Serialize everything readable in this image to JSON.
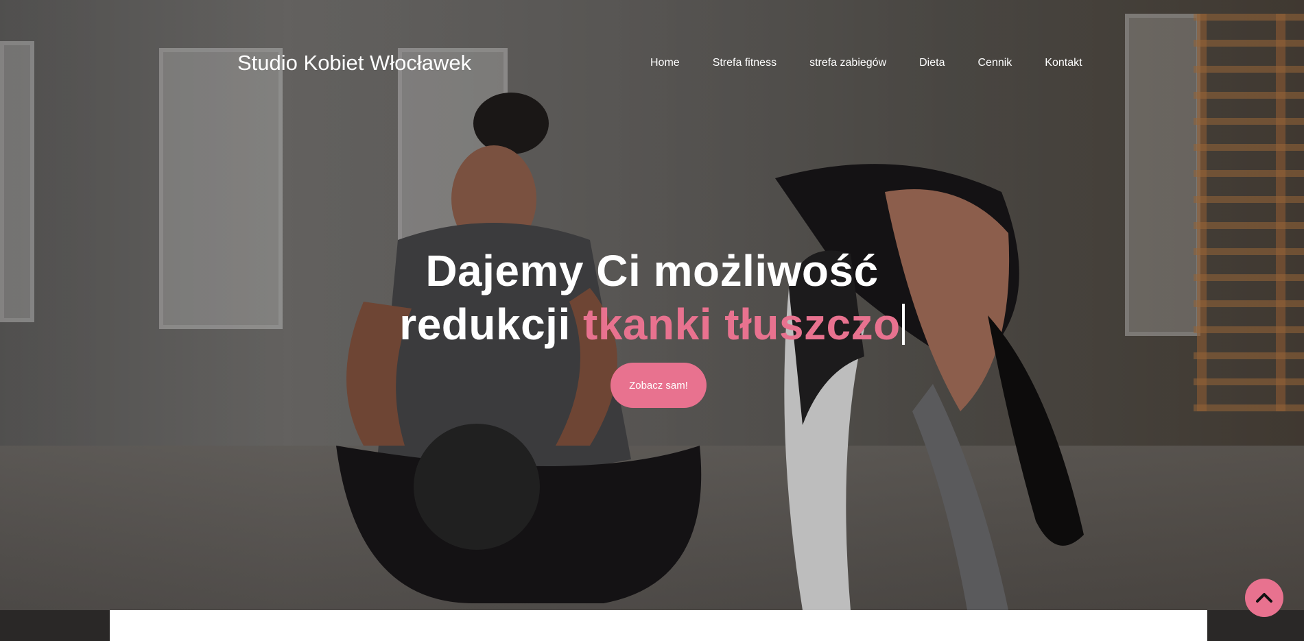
{
  "header": {
    "brand": "Studio Kobiet Włocławek",
    "nav": [
      {
        "label": "Home"
      },
      {
        "label": "Strefa fitness"
      },
      {
        "label": "strefa zabiegów"
      },
      {
        "label": "Dieta"
      },
      {
        "label": "Cennik"
      },
      {
        "label": "Kontakt"
      }
    ]
  },
  "hero": {
    "line1": "Dajemy Ci możliwość",
    "line2_prefix": "redukcji ",
    "line2_highlight": "tkanki tłuszczo",
    "cta_label": "Zobacz sam!"
  },
  "scroll_top": {
    "icon": "chevron-up-icon"
  },
  "colors": {
    "accent": "#e8728f",
    "text": "#ffffff",
    "overlay": "rgba(0,0,0,0.48)"
  }
}
